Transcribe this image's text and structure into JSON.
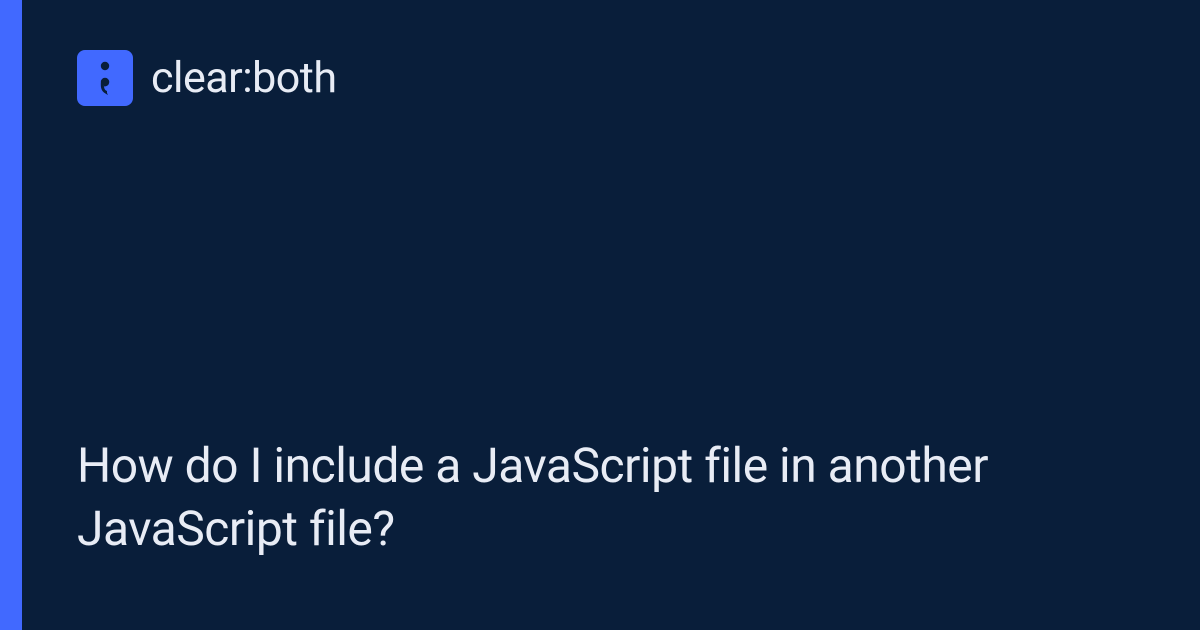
{
  "brand": {
    "name": "clear:both"
  },
  "colors": {
    "background": "#091e3a",
    "accent": "#4169ff",
    "text": "#e8ecf5"
  },
  "heading": "How do I include a JavaScript file in another JavaScript file?"
}
